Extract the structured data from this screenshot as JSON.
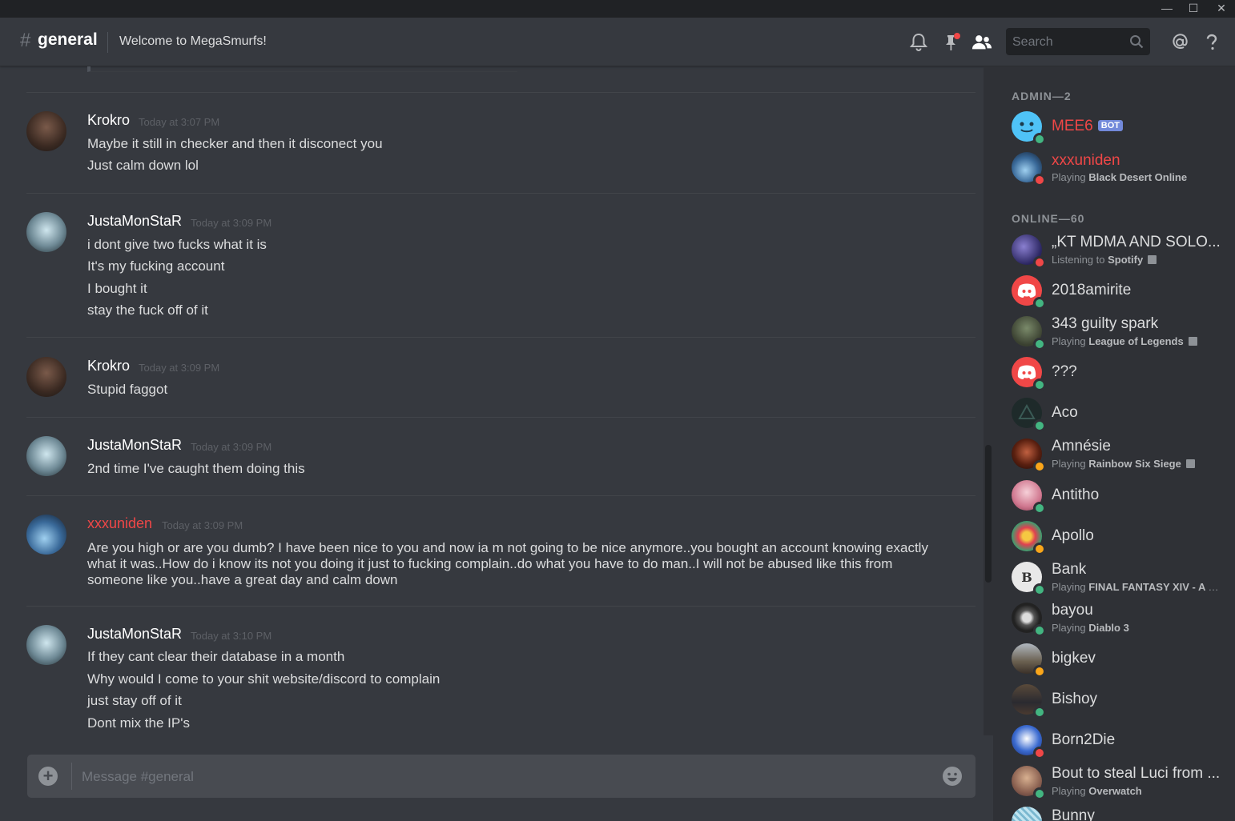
{
  "window": {
    "minimize": "—",
    "maximize": "☐",
    "close": "✕"
  },
  "header": {
    "hash": "#",
    "channel": "general",
    "topic": "Welcome to MegaSmurfs!",
    "search_placeholder": "Search"
  },
  "messages": [
    {
      "author": "Krokro",
      "timestamp": "Today at 3:07 PM",
      "author_color": "#ffffff",
      "lines": [
        "Maybe it still in checker and then it disconect you",
        "Just calm down lol"
      ]
    },
    {
      "author": "JustaMonStaR",
      "timestamp": "Today at 3:09 PM",
      "author_color": "#ffffff",
      "lines": [
        "i dont give two fucks what it is",
        "It's my fucking account",
        "I bought it",
        "stay the fuck off of it"
      ]
    },
    {
      "author": "Krokro",
      "timestamp": "Today at 3:09 PM",
      "author_color": "#ffffff",
      "lines": [
        "Stupid faggot"
      ]
    },
    {
      "author": "JustaMonStaR",
      "timestamp": "Today at 3:09 PM",
      "author_color": "#ffffff",
      "lines": [
        "2nd time I've caught them doing this"
      ]
    },
    {
      "author": "xxxuniden",
      "timestamp": "Today at 3:09 PM",
      "author_color": "#f04747",
      "paragraph": "Are you high or are you dumb? I have been nice to you and now ia m not going to be nice anymore..you bought an account knowing exactly what it was..How do i  know its not you doing it just to fucking complain..do what you have to do man..I will not be abused like this from someone like you..have a great day and calm down"
    },
    {
      "author": "JustaMonStaR",
      "timestamp": "Today at 3:10 PM",
      "author_color": "#ffffff",
      "lines": [
        "If they cant clear their database in a month",
        "Why would I come to your shit website/discord to complain",
        "just stay off of it",
        "Dont mix the IP's"
      ]
    }
  ],
  "composer": {
    "placeholder": "Message #general"
  },
  "members": {
    "admin_header": "ADMIN—2",
    "online_header": "ONLINE—60",
    "admins": [
      {
        "name": "MEE6",
        "bot_tag": "BOT",
        "status": "online",
        "name_color": "#f04747"
      },
      {
        "name": "xxxuniden",
        "activity_prefix": "Playing",
        "activity": "Black Desert Online",
        "status": "dnd",
        "name_color": "#f04747"
      }
    ],
    "online": [
      {
        "name": "„KT MDMA AND SOLO...",
        "activity_prefix": "Listening to",
        "activity": "Spotify",
        "status": "dnd",
        "rich": true
      },
      {
        "name": "2018amirite",
        "status": "online"
      },
      {
        "name": "343 guilty spark",
        "activity_prefix": "Playing",
        "activity": "League of Legends",
        "status": "online",
        "rich": true
      },
      {
        "name": "???",
        "status": "online"
      },
      {
        "name": "Aco",
        "status": "online"
      },
      {
        "name": "Amnésie",
        "activity_prefix": "Playing",
        "activity": "Rainbow Six Siege",
        "status": "idle",
        "rich": true
      },
      {
        "name": "Antitho",
        "status": "online"
      },
      {
        "name": "Apollo",
        "status": "idle"
      },
      {
        "name": "Bank",
        "activity_prefix": "Playing",
        "activity": "FINAL FANTASY XIV - A R...",
        "status": "online"
      },
      {
        "name": "bayou",
        "activity_prefix": "Playing",
        "activity": "Diablo 3",
        "status": "online"
      },
      {
        "name": "bigkev",
        "status": "idle"
      },
      {
        "name": "Bishoy",
        "status": "online"
      },
      {
        "name": "Born2Die",
        "status": "dnd"
      },
      {
        "name": "Bout to steal Luci from ...",
        "activity_prefix": "Playing",
        "activity": "Overwatch",
        "status": "online"
      },
      {
        "name": "Bunny",
        "status": "online"
      }
    ]
  },
  "colors": {
    "online": "#43b581",
    "idle": "#faa61a",
    "dnd": "#f04747",
    "accent": "#7289da"
  }
}
